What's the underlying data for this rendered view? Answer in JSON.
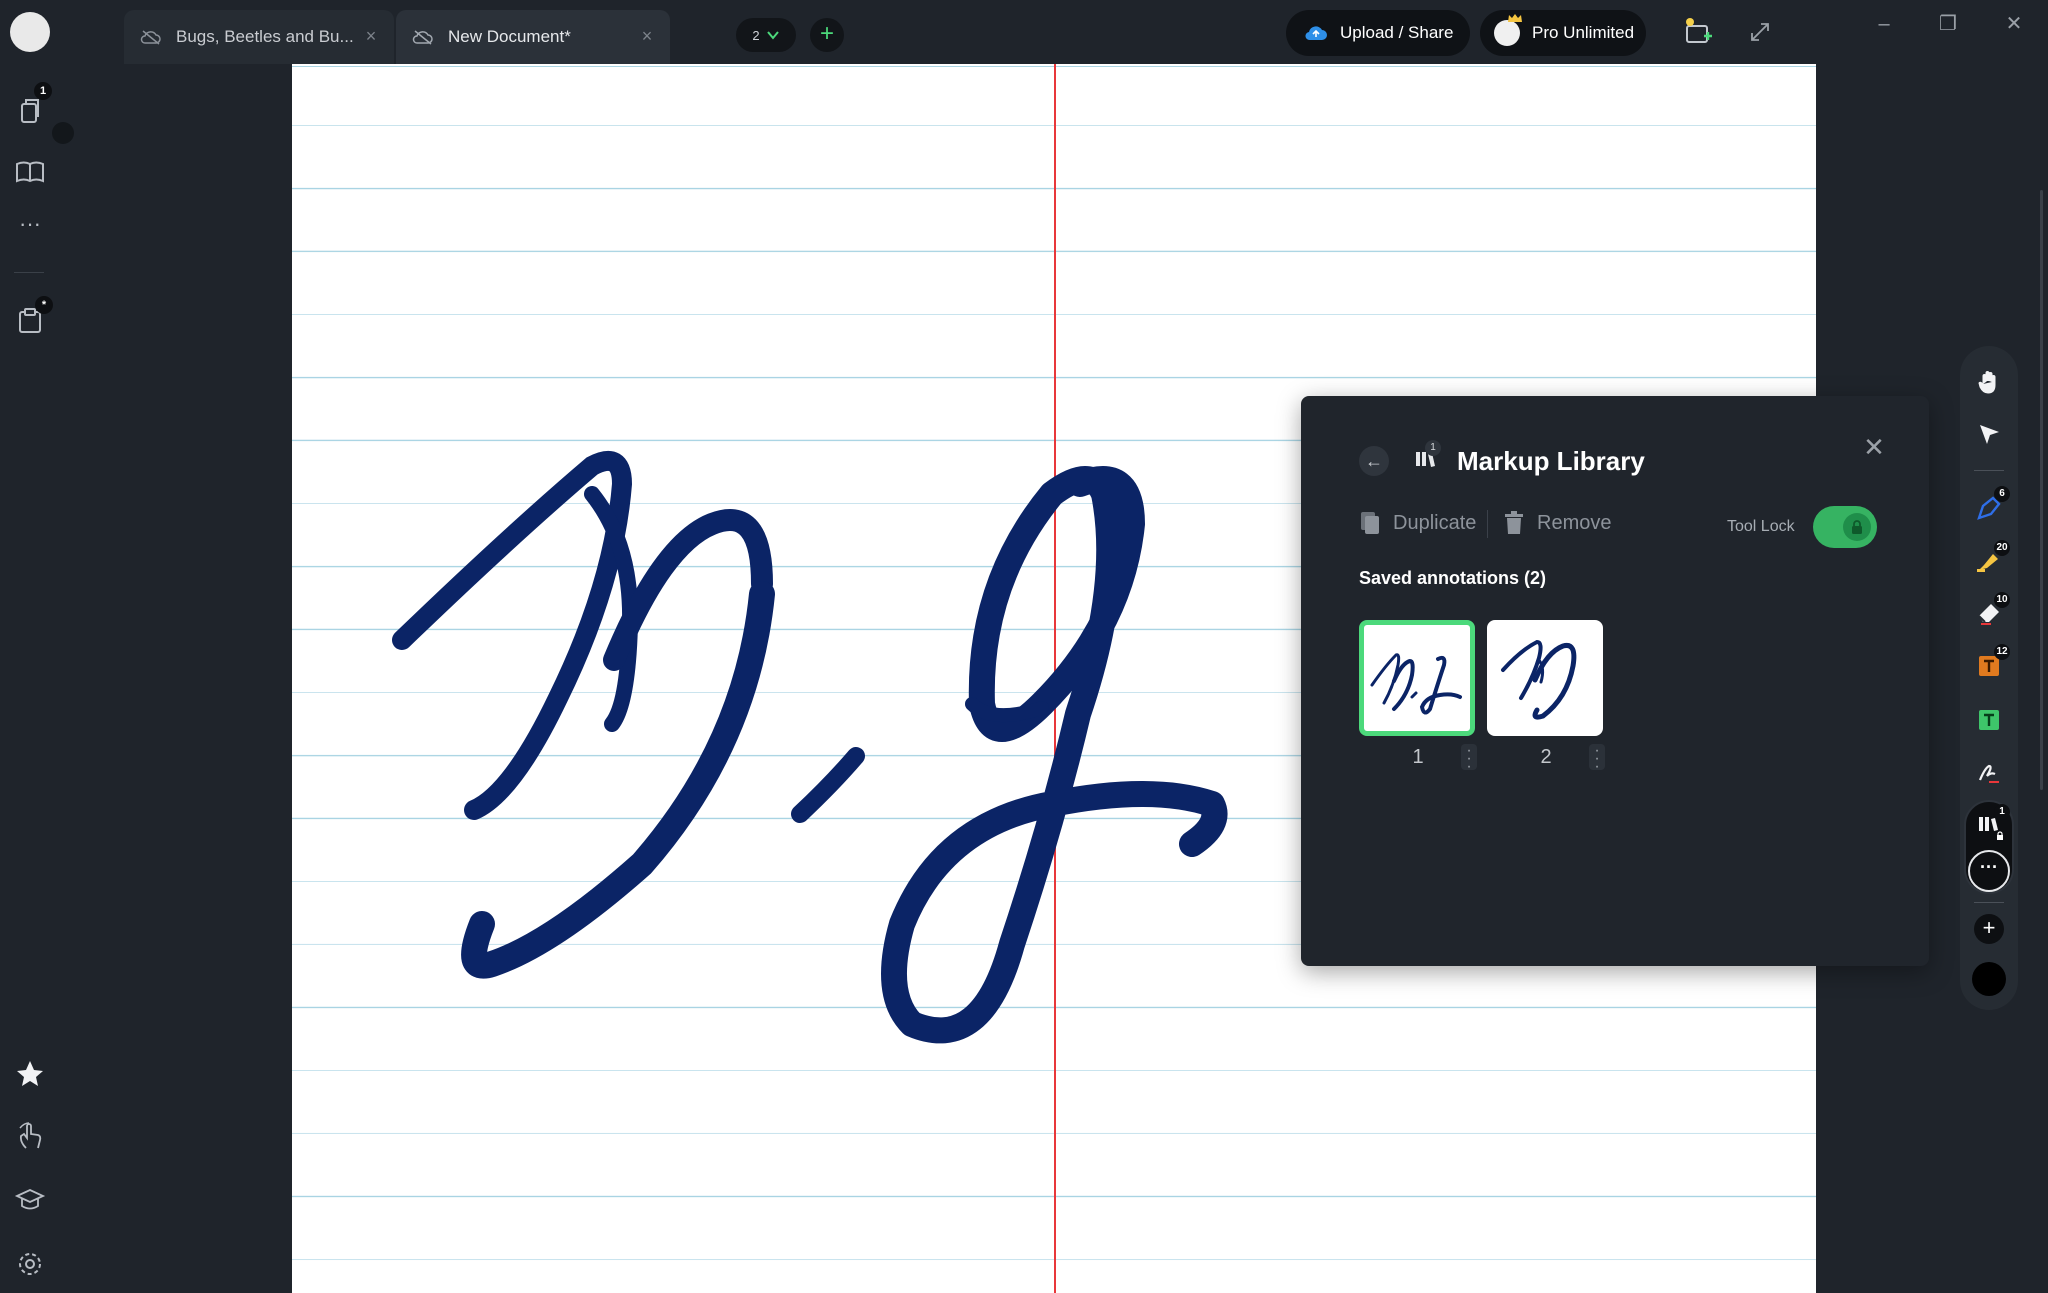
{
  "tabs": [
    {
      "label": "Bugs, Beetles and Bu..."
    },
    {
      "label": "New Document*"
    }
  ],
  "header": {
    "page_count": "2",
    "upload_label": "Upload / Share",
    "pro_label": "Pro Unlimited",
    "icons": [
      "cloud-icon",
      "chevron-down-icon",
      "plus-icon",
      "upload-cloud-icon",
      "crown-icon",
      "new-page-icon",
      "fullscreen-icon",
      "minimize-icon",
      "restore-icon",
      "close-icon"
    ]
  },
  "sidebar": {
    "pages_badge": "1",
    "clipboard_badge": "*",
    "icons": [
      "pages-icon",
      "book-icon",
      "more-icon",
      "clipboard-icon",
      "star-icon",
      "gesture-icon",
      "learn-icon",
      "settings-icon"
    ]
  },
  "panel": {
    "title": "Markup Library",
    "library_badge": "1",
    "duplicate_label": "Duplicate",
    "remove_label": "Remove",
    "tool_lock_label": "Tool Lock",
    "tool_lock_on": true,
    "saved_label": "Saved annotations (2)",
    "annotations": [
      {
        "number": "1",
        "selected": true
      },
      {
        "number": "2",
        "selected": false
      }
    ]
  },
  "toolbar": {
    "tools": [
      {
        "name": "hand-tool-icon"
      },
      {
        "name": "select-tool-icon"
      },
      {
        "name": "pen-tool-icon",
        "badge": "6"
      },
      {
        "name": "highlighter-tool-icon",
        "badge": "20"
      },
      {
        "name": "eraser-tool-icon",
        "badge": "10"
      },
      {
        "name": "text-box-tool-icon",
        "badge": "12"
      },
      {
        "name": "text-tool-icon"
      },
      {
        "name": "signature-tool-icon"
      },
      {
        "name": "markup-library-tool-icon",
        "badge": "1"
      }
    ],
    "current_color": "#000000"
  },
  "colors": {
    "ink": "#0b2466",
    "accent_green": "#4cd97b",
    "margin_red": "#e8373a",
    "rule_blue": "#a9d4e3"
  }
}
